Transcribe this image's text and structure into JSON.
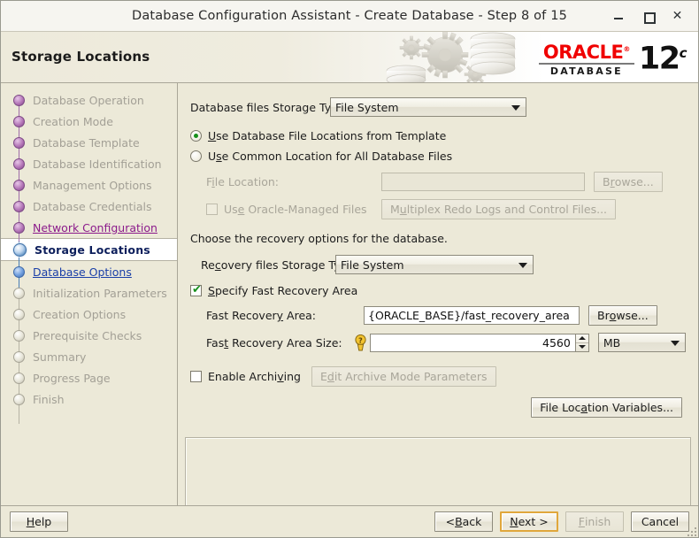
{
  "window": {
    "title": "Database Configuration Assistant - Create Database - Step 8 of 15",
    "minimize_icon": "minimize-icon",
    "maximize_icon": "maximize-icon",
    "close_icon": "close-icon",
    "close_glyph": "✕"
  },
  "header": {
    "page_title": "Storage Locations",
    "brand_name": "ORACLE",
    "brand_trademark": "®",
    "brand_product": "DATABASE",
    "brand_version": "12",
    "brand_version_suffix": "c"
  },
  "sidebar": {
    "items": [
      {
        "label": "Database Operation",
        "state": "done"
      },
      {
        "label": "Creation Mode",
        "state": "done"
      },
      {
        "label": "Database Template",
        "state": "done"
      },
      {
        "label": "Database Identification",
        "state": "done"
      },
      {
        "label": "Management Options",
        "state": "done"
      },
      {
        "label": "Database Credentials",
        "state": "done"
      },
      {
        "label": "Network Configuration",
        "state": "visited"
      },
      {
        "label": "Storage Locations",
        "state": "current"
      },
      {
        "label": "Database Options",
        "state": "next"
      },
      {
        "label": "Initialization Parameters",
        "state": "pending"
      },
      {
        "label": "Creation Options",
        "state": "pending"
      },
      {
        "label": "Prerequisite Checks",
        "state": "pending"
      },
      {
        "label": "Summary",
        "state": "pending"
      },
      {
        "label": "Progress Page",
        "state": "pending"
      },
      {
        "label": "Finish",
        "state": "pending"
      }
    ]
  },
  "main": {
    "db_storage_type_label": "Database files Storage Type:",
    "db_storage_type_value": "File System",
    "radio_template_label": "Use Database File Locations from Template",
    "radio_common_label": "Use Common Location for All Database Files",
    "file_location_label": "File Location:",
    "file_location_value": "",
    "file_location_browse": "Browse...",
    "omf_checkbox_label": "Use Oracle-Managed Files",
    "multiplex_button": "Multiplex Redo Logs and Control Files...",
    "recovery_intro": "Choose the recovery options for the database.",
    "recovery_storage_type_label": "Recovery files Storage Type:",
    "recovery_storage_type_value": "File System",
    "specify_fra_label": "Specify Fast Recovery Area",
    "fra_label": "Fast Recovery Area:",
    "fra_value": "{ORACLE_BASE}/fast_recovery_area",
    "fra_browse": "Browse...",
    "fra_size_label": "Fast Recovery Area Size:",
    "fra_size_value": "4560",
    "fra_size_unit": "MB",
    "enable_archiving_label": "Enable Archiving",
    "edit_archive_button": "Edit Archive Mode Parameters",
    "file_location_variables_button": "File Location Variables...",
    "message_panel_text": ""
  },
  "footer": {
    "help": "Help",
    "back": "< Back",
    "next": "Next >",
    "finish": "Finish",
    "cancel": "Cancel"
  },
  "colors": {
    "window_bg": "#ece9d8",
    "oracle_red": "#f00000",
    "current_step_text": "#0d1f5c",
    "visited_link": "#8b1a8b",
    "next_link": "#1a3fa8",
    "focus_border": "#e0a73c",
    "check_green": "#17901c"
  }
}
